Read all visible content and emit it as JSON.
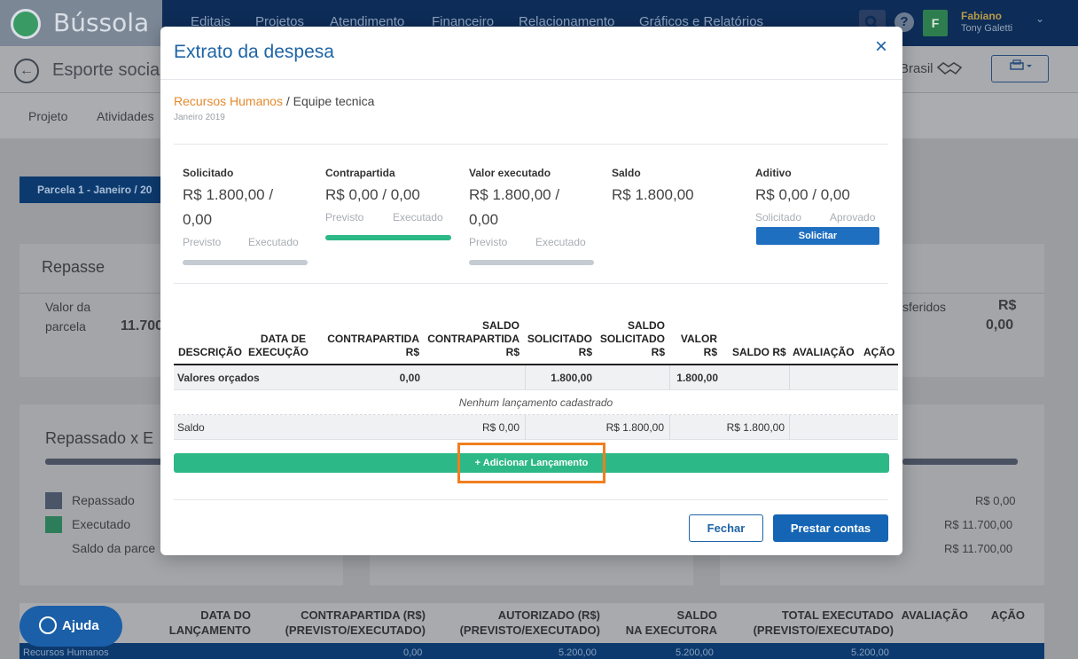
{
  "app": {
    "name": "Bússola"
  },
  "nav": {
    "items": [
      "Editais",
      "Projetos",
      "Atendimento",
      "Financeiro",
      "Relacionamento",
      "Gráficos e Relatórios"
    ],
    "help": "?",
    "user_initial": "F",
    "user_name": "Fabiano",
    "user_sub": "Tony Galetti"
  },
  "page": {
    "title": "Esporte socia",
    "region": "Brasil",
    "tabs": [
      "Projeto",
      "Atividades"
    ]
  },
  "background": {
    "parcela_button": "Parcela 1 - Janeiro / 20",
    "repasse_title": "Repasse",
    "valor_parcela_line1": "Valor da",
    "valor_parcela_line2": "parcela",
    "valor_parcela_value": "11.700",
    "transferidos_label": "sferidos",
    "transferidos_currency": "R$",
    "transferidos_value": "0,00",
    "chart_title": "Repassado x E",
    "legend": [
      {
        "label": "Repassado",
        "color": "#4a5568"
      },
      {
        "label": "Executado",
        "color": "#2e7d5a"
      }
    ],
    "saldo_parcela": "Saldo da parce",
    "right_values": [
      "R$ 0,00",
      "R$ 11.700,00",
      "R$ 11.700,00"
    ],
    "help_button": "Ajuda",
    "bottom_headers": [
      {
        "line1": "DATA DO",
        "line2": "LANÇAMENTO"
      },
      {
        "line1": "CONTRAPARTIDA (R$)",
        "line2": "(PREVISTO/EXECUTADO)"
      },
      {
        "line1": "AUTORIZADO (R$)",
        "line2": "(PREVISTO/EXECUTADO)"
      },
      {
        "line1": "SALDO",
        "line2": "NA EXECUTORA"
      },
      {
        "line1": "TOTAL EXECUTADO",
        "line2": "(PREVISTO/EXECUTADO)"
      },
      {
        "line1": "",
        "line2": "AVALIAÇÃO"
      },
      {
        "line1": "",
        "line2": "AÇÃO"
      }
    ],
    "bottom_row": [
      "Recursos Humanos",
      "0,00",
      "5.200,00",
      "5.200,00",
      "5.200,00"
    ]
  },
  "modal": {
    "title": "Extrato da despesa",
    "close": "×",
    "category": "Recursos Humanos",
    "separator": " / ",
    "subcategory": "Equipe tecnica",
    "period": "Janeiro 2019",
    "summary": {
      "solicitado": {
        "label": "Solicitado",
        "value_line1": "R$ 1.800,00 /",
        "value_line2": "0,00",
        "cap1": "Previsto",
        "cap2": "Executado",
        "progress": 0
      },
      "contrapartida": {
        "label": "Contrapartida",
        "value_line1": "R$ 0,00 / 0,00",
        "cap1": "Previsto",
        "cap2": "Executado",
        "progress": 1
      },
      "valor_executado": {
        "label": "Valor executado",
        "value_line1": "R$ 1.800,00 /",
        "value_line2": "0,00",
        "cap1": "Previsto",
        "cap2": "Executado",
        "progress": 0
      },
      "saldo": {
        "label": "Saldo",
        "value_line1": "R$ 1.800,00"
      },
      "aditivo": {
        "label": "Aditivo",
        "value_line1": "R$ 0,00 / 0,00",
        "cap1": "Solicitado",
        "cap2": "Aprovado",
        "button": "Solicitar"
      }
    },
    "table": {
      "headers": {
        "descricao": "DESCRIÇÃO",
        "data_l1": "DATA DE",
        "data_l2": "EXECUÇÃO",
        "contra_l1": "CONTRAPARTIDA",
        "contra_l2": "R$",
        "saldo_contra_l1": "SALDO",
        "saldo_contra_l2": "CONTRAPARTIDA",
        "saldo_contra_l3": "R$",
        "solicitado_l1": "SOLICITADO",
        "solicitado_l2": "R$",
        "saldo_sol_l1": "SALDO",
        "saldo_sol_l2": "SOLICITADO",
        "saldo_sol_l3": "R$",
        "valor_l1": "VALOR",
        "valor_l2": "R$",
        "saldo_rs": "SALDO R$",
        "avaliacao": "AVALIAÇÃO",
        "acao": "AÇÃO"
      },
      "row_orcados": {
        "label": "Valores orçados",
        "contrapartida": "0,00",
        "solicitado": "1.800,00",
        "valor": "1.800,00"
      },
      "empty_message": "Nenhum lançamento cadastrado",
      "row_saldo": {
        "label": "Saldo",
        "contra": "R$ 0,00",
        "solicitado": "R$ 1.800,00",
        "valor": "R$ 1.800,00"
      }
    },
    "add_button": "Adicionar Lançamento",
    "add_icon": "+",
    "buttons": {
      "fechar": "Fechar",
      "prestar": "Prestar contas"
    }
  },
  "colors": {
    "primary": "#1e64a6",
    "accent_orange": "#e38a2d",
    "success": "#2db887",
    "highlight": "#f07e1f"
  }
}
